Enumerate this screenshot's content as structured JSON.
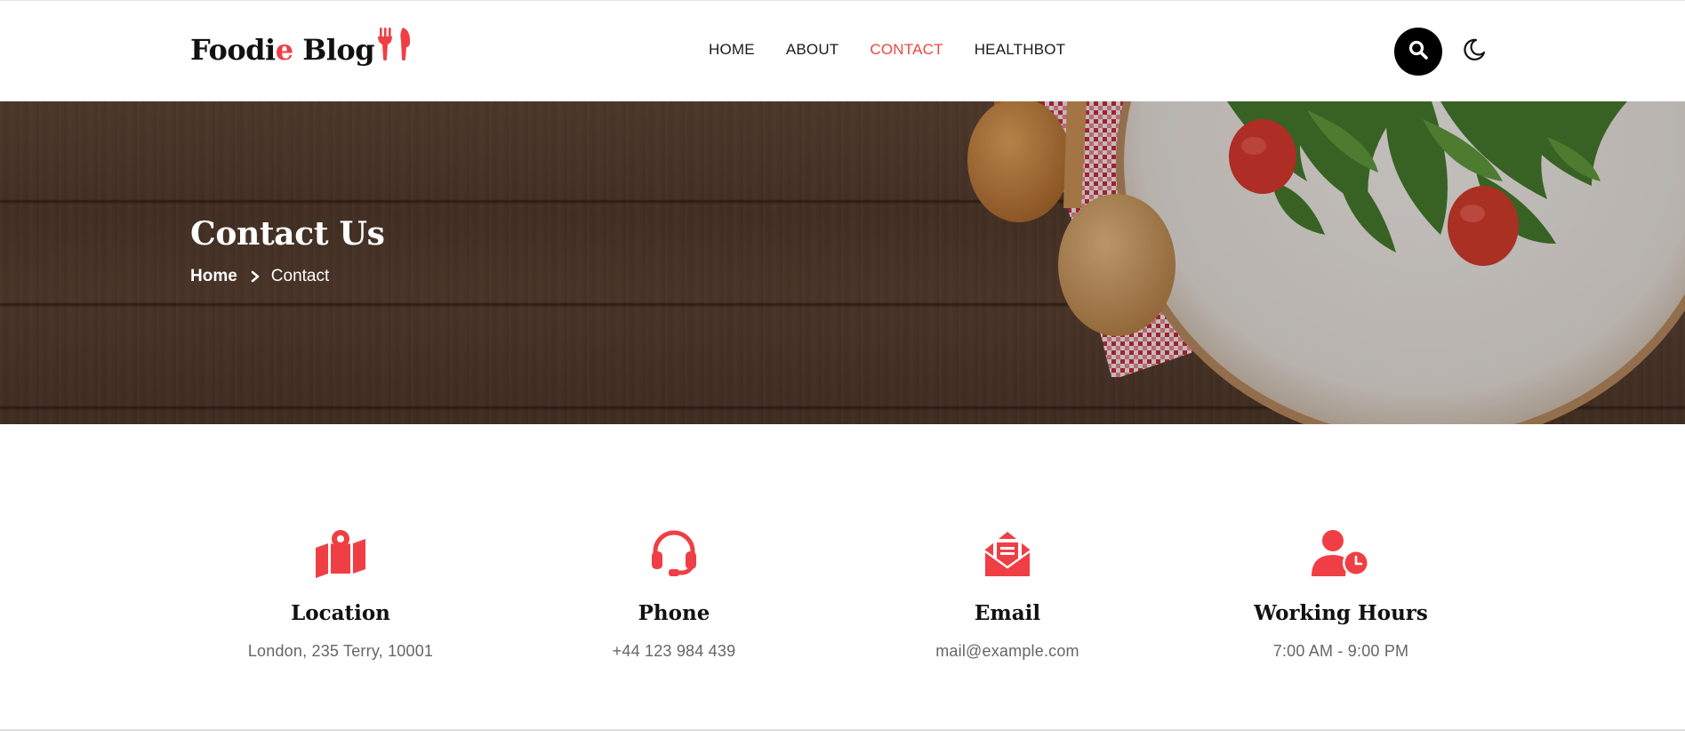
{
  "header": {
    "logo": {
      "text_start": "Foodi",
      "text_accent": "e",
      "text_end": " Blog",
      "icon": "cutlery-icon"
    },
    "nav": [
      {
        "label": "HOME",
        "active": false
      },
      {
        "label": "ABOUT",
        "active": false
      },
      {
        "label": "CONTACT",
        "active": true
      },
      {
        "label": "HEALTHBOT",
        "active": false
      }
    ],
    "search_icon": "search-icon",
    "theme_icon": "moon-icon"
  },
  "hero": {
    "title": "Contact Us",
    "breadcrumb": {
      "home": "Home",
      "current": "Contact"
    }
  },
  "contact_info": [
    {
      "icon": "map-pin-icon",
      "title": "Location",
      "value": "London, 235 Terry, 10001"
    },
    {
      "icon": "headset-icon",
      "title": "Phone",
      "value": "+44 123 984 439"
    },
    {
      "icon": "envelope-open-icon",
      "title": "Email",
      "value": "mail@example.com"
    },
    {
      "icon": "user-clock-icon",
      "title": "Working Hours",
      "value": "7:00 AM - 9:00 PM"
    }
  ],
  "colors": {
    "accent": "#f03e45",
    "nav_active": "#e9473f",
    "text": "#111111",
    "muted": "#666666"
  }
}
